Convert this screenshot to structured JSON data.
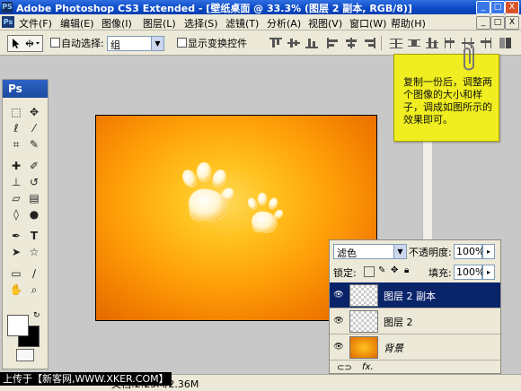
{
  "window": {
    "app_icon": "PS",
    "title": "Adobe Photoshop CS3 Extended - [壁纸桌面 @ 33.3% (图层 2 副本, RGB/8)]",
    "controls": [
      "_",
      "□",
      "X"
    ],
    "doc_controls": [
      "_",
      "□",
      "X"
    ]
  },
  "menu": [
    "文件(F)",
    "编辑(E)",
    "图像(I)",
    "图层(L)",
    "选择(S)",
    "滤镜(T)",
    "分析(A)",
    "视图(V)",
    "窗口(W)",
    "帮助(H)"
  ],
  "options": {
    "auto_select_label": "自动选择:",
    "auto_select_value": "组",
    "show_transform_label": "显示变换控件"
  },
  "toolbox": {
    "header": "Ps",
    "tools": [
      "marquee-icon",
      "move-icon",
      "lasso-icon",
      "magic-wand-icon",
      "crop-icon",
      "slice-icon",
      "healing-icon",
      "brush-icon",
      "stamp-icon",
      "history-brush-icon",
      "eraser-icon",
      "gradient-icon",
      "blur-icon",
      "dodge-icon",
      "pen-icon",
      "type-icon",
      "path-select-icon",
      "shape-icon",
      "notes-icon",
      "eyedropper-icon",
      "hand-icon",
      "zoom-icon"
    ],
    "foreground_color": "#ffffff",
    "background_color": "#000000"
  },
  "note": {
    "text": "复制一份后，调整两个图像的大小和样子，调成如图所示的效果即可。"
  },
  "layers": {
    "blend_mode": "滤色",
    "opacity_label": "不透明度:",
    "opacity_value": "100%",
    "lock_label": "锁定:",
    "fill_label": "填充:",
    "fill_value": "100%",
    "items": [
      {
        "name": "图层 2 副本",
        "selected": true
      },
      {
        "name": "图层 2",
        "selected": false
      },
      {
        "name": "背景",
        "selected": false
      }
    ]
  },
  "status": {
    "doc_size": "文档:2.25M/2.36M"
  },
  "footer": {
    "text": "上传于【新客网,WWW.XKER.COM】"
  },
  "colors": {
    "titlebar": "#0b49c4",
    "selected_layer": "#0a246a",
    "canvas_center": "#ffd95a",
    "canvas_edge": "#de6200",
    "note": "#f0ee20"
  }
}
